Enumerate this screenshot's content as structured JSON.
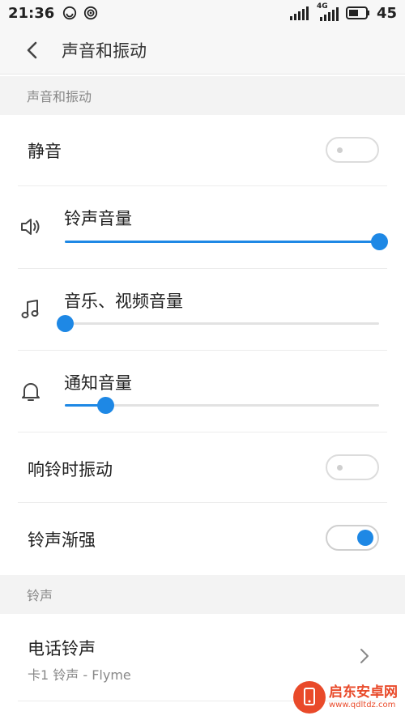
{
  "status_bar": {
    "time": "21:36",
    "network_type": "4G",
    "battery_level": "45"
  },
  "app_bar": {
    "title": "声音和振动"
  },
  "sections": {
    "sound": {
      "header": "声音和振动"
    },
    "ringtone": {
      "header": "铃声"
    }
  },
  "settings": {
    "mute": {
      "label": "静音",
      "enabled": false
    },
    "ring_volume": {
      "label": "铃声音量",
      "level": 1.0
    },
    "media_volume": {
      "label": "音乐、视频音量",
      "level": 0.0
    },
    "notification_volume": {
      "label": "通知音量",
      "level": 0.13
    },
    "vibrate_on_ring": {
      "label": "响铃时振动",
      "enabled": false
    },
    "ringtone_fade_in": {
      "label": "铃声渐强",
      "enabled": true
    },
    "phone_ringtone": {
      "label": "电话铃声",
      "value": "卡1 铃声 - Flyme"
    }
  },
  "watermark": {
    "title": "启东安卓网",
    "url": "www.qdltdz.com"
  },
  "colors": {
    "accent": "#1e88e5",
    "track": "#e2e2e2",
    "section_bg": "#f3f3f3"
  }
}
